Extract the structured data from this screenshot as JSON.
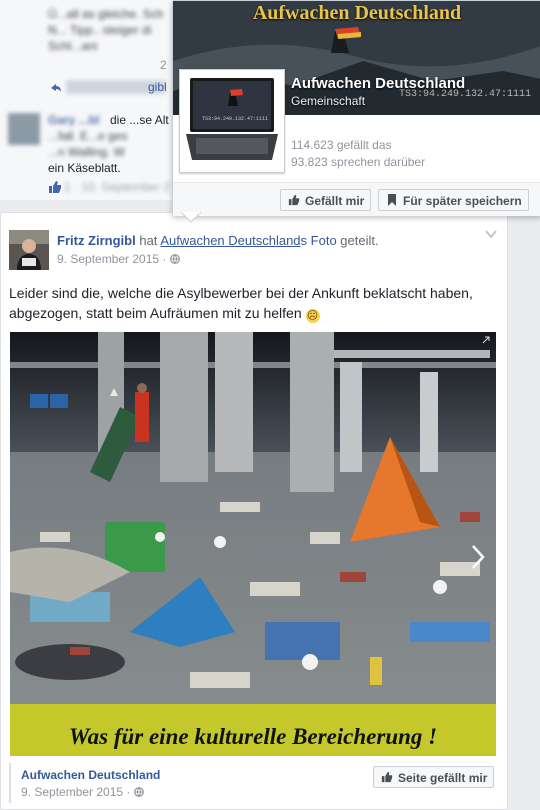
{
  "colors": {
    "fb_link": "#365899",
    "meta": "#90949c",
    "gold": "#e8c54a",
    "caption_bg": "#c5c82a"
  },
  "feed_fragment": {
    "line1": "Ü...all as gleiche. Sch",
    "line2": "N... Tipp.. steiger di",
    "line3": "Schl...ani",
    "line3_tail": "2",
    "like_link": "gibl",
    "comment_author": "Gary ...bl",
    "comment_line1": "die ...se Alt",
    "comment_line2": "...fall. E...e ges",
    "comment_line3": "...n Walling. W",
    "comment_line4": "ein Käseblatt.",
    "comment_meta": "1 · 10. September 2"
  },
  "hover_card": {
    "cover_title": "Aufwachen Deutschland",
    "cover_ts": "TS3:94.249.132.47:1111",
    "pic_ts": "TS3:94.249.132.47:1111",
    "page_name": "Aufwachen Deutschland",
    "category": "Gemeinschaft",
    "likes": "114.623 gefällt das",
    "talking": "93.823 sprechen darüber",
    "like_button": "Gefällt mir",
    "save_button": "Für später speichern",
    "like_icon": "thumbs-up-icon",
    "save_icon": "bookmark-icon"
  },
  "post": {
    "author": "Fritz Zirngibl",
    "verb1": "hat",
    "page_link": "Aufwachen Deutschland",
    "suffix_s": "s",
    "photo_link": "Foto",
    "verb2": "geteilt.",
    "date": "9. September 2015 ·",
    "privacy_icon": "globe-icon",
    "text_line1": "Leider sind die, welche die Asylbewerber bei der Ankunft beklatscht haben,",
    "text_line2": "abgezogen, statt beim Aufräumen mit zu helfen",
    "emoji": "☹",
    "caption": "Was für eine kulturelle Bereicherung !",
    "shared_page": "Aufwachen Deutschland",
    "shared_date": "9. September 2015 ·",
    "page_like_button": "Seite gefällt mir"
  }
}
